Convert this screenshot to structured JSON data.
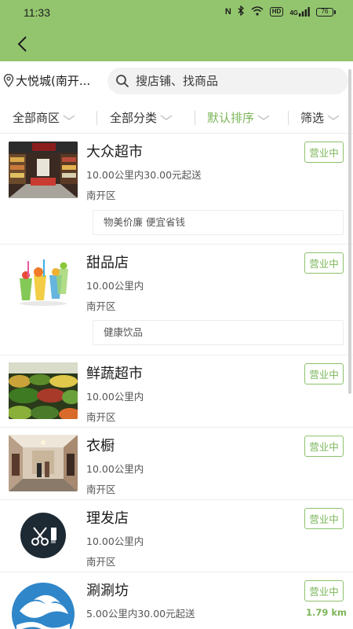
{
  "status_bar": {
    "time": "11:33",
    "signal_text": "4G",
    "hd_label": "HD",
    "battery": "76",
    "nfc_label": "N"
  },
  "header": {
    "back_icon": "chevron-left-icon",
    "background": "#93c56e"
  },
  "location": {
    "text": "大悦城(南开...",
    "icon": "location-pin-icon"
  },
  "search": {
    "placeholder": "搜店铺、找商品",
    "value": "",
    "icon": "search-icon"
  },
  "filters": [
    {
      "label": "全部商区",
      "active": false
    },
    {
      "label": "全部分类",
      "active": false
    },
    {
      "label": "默认排序",
      "active": true
    },
    {
      "label": "筛选",
      "active": false
    }
  ],
  "accent_color": "#7cb65a",
  "stores": [
    {
      "name": "大众超市",
      "desc": "10.00公里内30.00元起送",
      "area": "南开区",
      "status": "营业中",
      "tagline": "物美价廉 便宜省钱",
      "image": "supermarket-aisle"
    },
    {
      "name": "甜品店",
      "desc": "10.00公里内",
      "area": "南开区",
      "status": "营业中",
      "tagline": "健康饮品",
      "image": "fruit-drinks"
    },
    {
      "name": "鲜蔬超市",
      "desc": "10.00公里内",
      "area": "南开区",
      "status": "营业中",
      "image": "vegetable-stand"
    },
    {
      "name": "衣橱",
      "desc": "10.00公里内",
      "area": "南开区",
      "status": "营业中",
      "image": "clothing-store"
    },
    {
      "name": "理发店",
      "desc": "10.00公里内",
      "area": "南开区",
      "status": "营业中",
      "image": "barber-logo"
    },
    {
      "name": "涮涮坊",
      "desc": "5.00公里内30.00元起送",
      "status": "营业中",
      "distance": "1.79 km",
      "image": "hotpot-logo"
    }
  ]
}
